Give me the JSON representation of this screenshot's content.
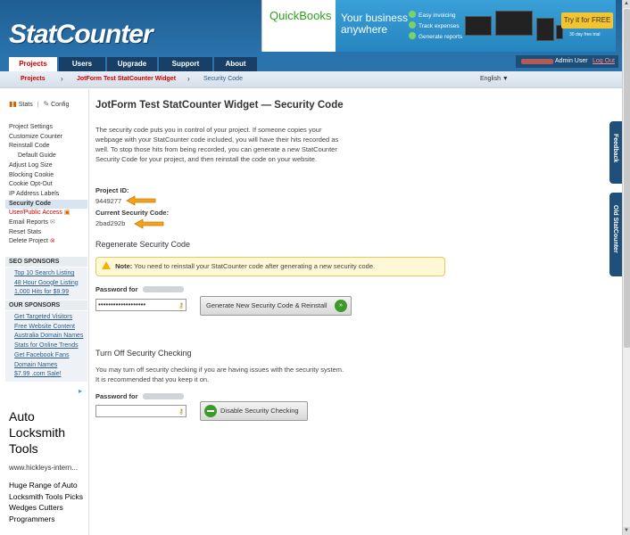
{
  "header": {
    "logo": "StatCounter"
  },
  "ad_banner": {
    "brand": "QuickBooks",
    "tagline": "Your business anywhere",
    "checks": [
      "Easy invoicing",
      "Track expenses",
      "Generate reports"
    ],
    "cta": "Try it for FREE",
    "trial": "30 day free trial"
  },
  "tabs": [
    {
      "label": "Projects"
    },
    {
      "label": "Users"
    },
    {
      "label": "Upgrade"
    },
    {
      "label": "Support"
    },
    {
      "label": "About"
    }
  ],
  "adminbar": {
    "role": "Admin User",
    "logout": "Log Out"
  },
  "breadcrumb": {
    "items": [
      "Projects",
      "JotForm Test StatCounter Widget",
      "Security Code"
    ],
    "language": "English"
  },
  "sidebar": {
    "stats": "Stats",
    "config": "Config",
    "menu": [
      "Project Settings",
      "Customize Counter",
      "Reinstall Code",
      "Default Guide",
      "Adjust Log Size",
      "Blocking Cookie",
      "Cookie Opt-Out",
      "IP Address Labels",
      "Security Code",
      "User/Public Access",
      "Email Reports",
      "Reset Stats",
      "Delete Project"
    ],
    "seo_heading": "SEO SPONSORS",
    "seo_links": [
      "Top 10 Search Listing",
      "48 Hour Google Listing",
      "1,000 Hits for $9.99"
    ],
    "our_heading": "OUR SPONSORS",
    "our_links": [
      "Get Targeted Visitors",
      "Free Website Content",
      "Australia Domain Names",
      "Stats for Online Trends",
      "Get Facebook Fans",
      "Domain Names",
      "$7.99 .com Sale!"
    ],
    "ad": {
      "title": "Auto Locksmith Tools",
      "url": "www.hickleys-intern...",
      "desc": "Huge Range of Auto Locksmith Tools Picks Wedges Cutters Programmers"
    }
  },
  "main": {
    "title": "JotForm Test StatCounter Widget — Security Code",
    "intro": "The security code puts you in control of your project. If someone copies your webpage with your StatCounter code included, you will have their hits recorded as well. To stop those hits from being recorded, you can generate a new StatCounter Security Code for your project, and then reinstall the code on your website.",
    "project_id_label": "Project ID:",
    "project_id": "9449277",
    "security_code_label": "Current Security Code:",
    "security_code": "2bad292b",
    "regen_heading": "Regenerate Security Code",
    "note_label": "Note:",
    "note_text": "You need to reinstall your StatCounter code after generating a new security code.",
    "password_label": "Password for",
    "password_value": "•••••••••••••••••••",
    "regen_button": "Generate New Security Code & Reinstall",
    "off_heading": "Turn Off Security Checking",
    "off_text": "You may turn off security checking if you are having issues with the security system. It is recommended that you keep it on.",
    "password_label2": "Password for",
    "disable_button": "Disable Security Checking"
  },
  "right_tabs": {
    "feedback": "Feedback",
    "old": "Old StatCounter"
  }
}
